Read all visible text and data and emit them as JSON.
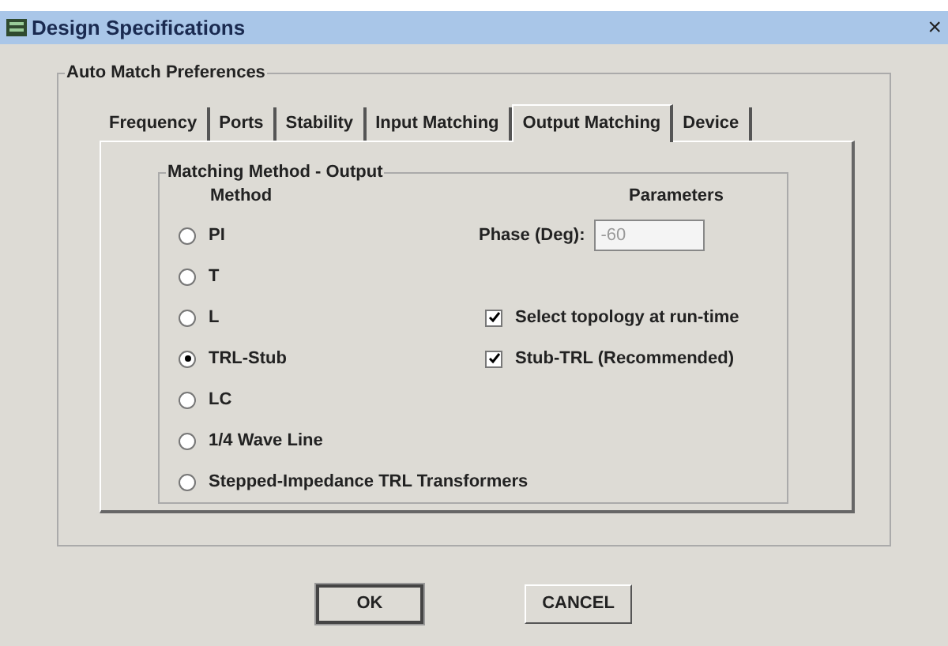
{
  "window": {
    "title": "Design Specifications",
    "close": "×"
  },
  "group": {
    "title": "Auto Match Preferences"
  },
  "tabs": [
    {
      "label": "Frequency",
      "selected": false
    },
    {
      "label": "Ports",
      "selected": false
    },
    {
      "label": "Stability",
      "selected": false
    },
    {
      "label": "Input Matching",
      "selected": false
    },
    {
      "label": "Output Matching",
      "selected": true
    },
    {
      "label": "Device",
      "selected": false
    }
  ],
  "panel": {
    "title": "Matching Method - Output",
    "method_heading": "Method",
    "parameters_heading": "Parameters",
    "methods": [
      {
        "label": "PI",
        "selected": false
      },
      {
        "label": "T",
        "selected": false
      },
      {
        "label": "L",
        "selected": false
      },
      {
        "label": "TRL-Stub",
        "selected": true
      },
      {
        "label": "LC",
        "selected": false
      },
      {
        "label": "1/4 Wave Line",
        "selected": false
      },
      {
        "label": "Stepped-Impedance TRL Transformers",
        "selected": false
      }
    ],
    "phase": {
      "label": "Phase (Deg):",
      "value": "-60",
      "disabled": true
    },
    "options": [
      {
        "label": "Select topology at run-time",
        "checked": true
      },
      {
        "label": "Stub-TRL (Recommended)",
        "checked": true
      }
    ]
  },
  "buttons": [
    {
      "label": "OK",
      "default": true
    },
    {
      "label": "CANCEL",
      "default": false
    }
  ]
}
